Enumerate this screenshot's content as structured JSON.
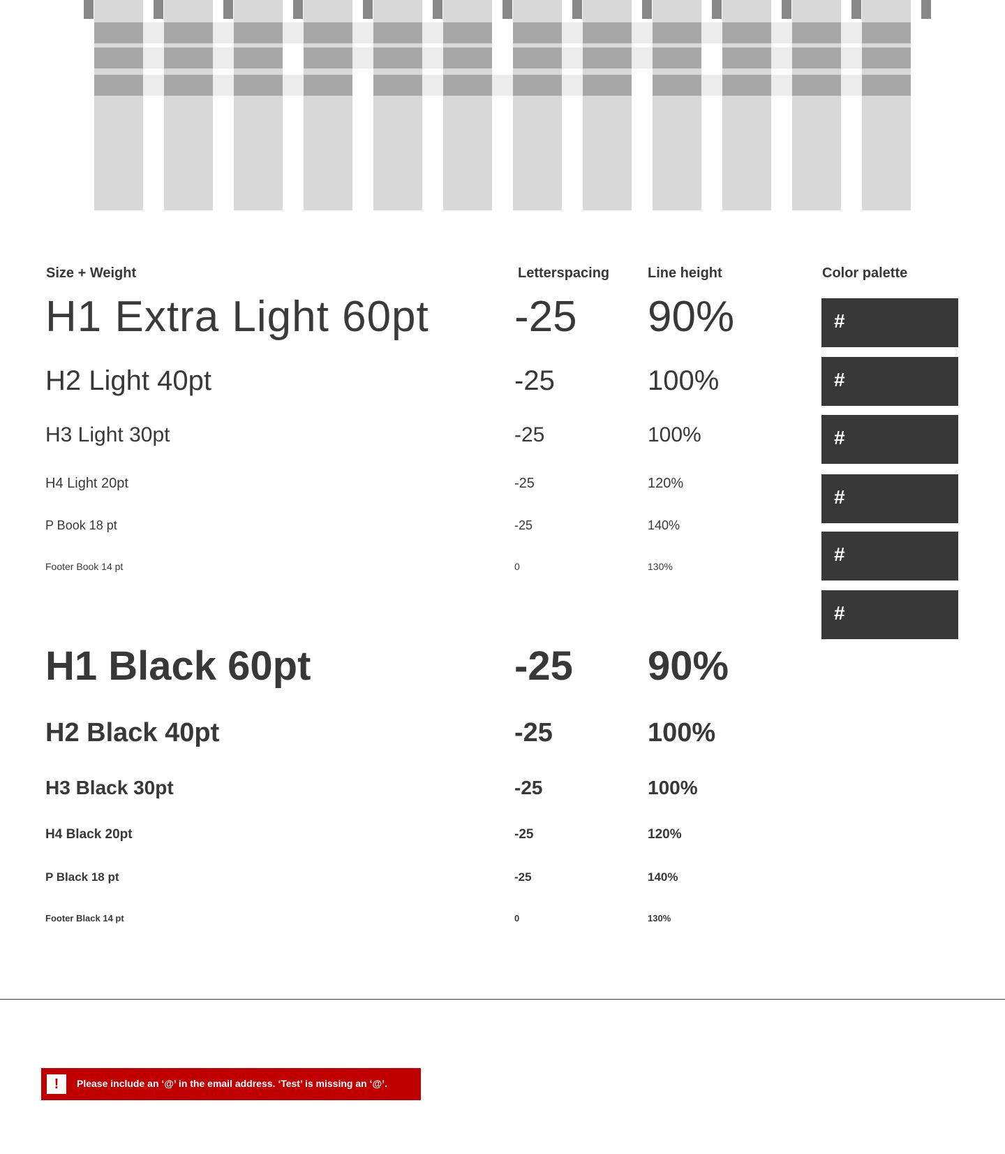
{
  "headers": {
    "size_weight": "Size + Weight",
    "letterspacing": "Letterspacing",
    "line_height": "Line height",
    "color_palette": "Color palette"
  },
  "light_styles": [
    {
      "name": "H1 Extra Light 60pt",
      "letterspacing": "-25",
      "line_height": "90%"
    },
    {
      "name": "H2 Light 40pt",
      "letterspacing": "-25",
      "line_height": "100%"
    },
    {
      "name": "H3 Light 30pt",
      "letterspacing": "-25",
      "line_height": "100%"
    },
    {
      "name": "H4 Light 20pt",
      "letterspacing": "-25",
      "line_height": "120%"
    },
    {
      "name": "P Book 18 pt",
      "letterspacing": "-25",
      "line_height": "140%"
    },
    {
      "name": "Footer Book 14 pt",
      "letterspacing": "0",
      "line_height": "130%"
    }
  ],
  "black_styles": [
    {
      "name": "H1 Black 60pt",
      "letterspacing": "-25",
      "line_height": "90%"
    },
    {
      "name": "H2 Black 40pt",
      "letterspacing": "-25",
      "line_height": "100%"
    },
    {
      "name": "H3 Black 30pt",
      "letterspacing": "-25",
      "line_height": "100%"
    },
    {
      "name": "H4 Black 20pt",
      "letterspacing": "-25",
      "line_height": "120%"
    },
    {
      "name": "P Black 18 pt",
      "letterspacing": "-25",
      "line_height": "140%"
    },
    {
      "name": "Footer Black 14 pt",
      "letterspacing": "0",
      "line_height": "130%"
    }
  ],
  "palette": [
    "#",
    "#",
    "#",
    "#",
    "#",
    "#"
  ],
  "palette_color": "#383838",
  "validation": {
    "icon": "!",
    "message": "Please include an ‘@’ in the email address. ‘Test’ is missing an ‘@’.",
    "color": "#c00000"
  }
}
